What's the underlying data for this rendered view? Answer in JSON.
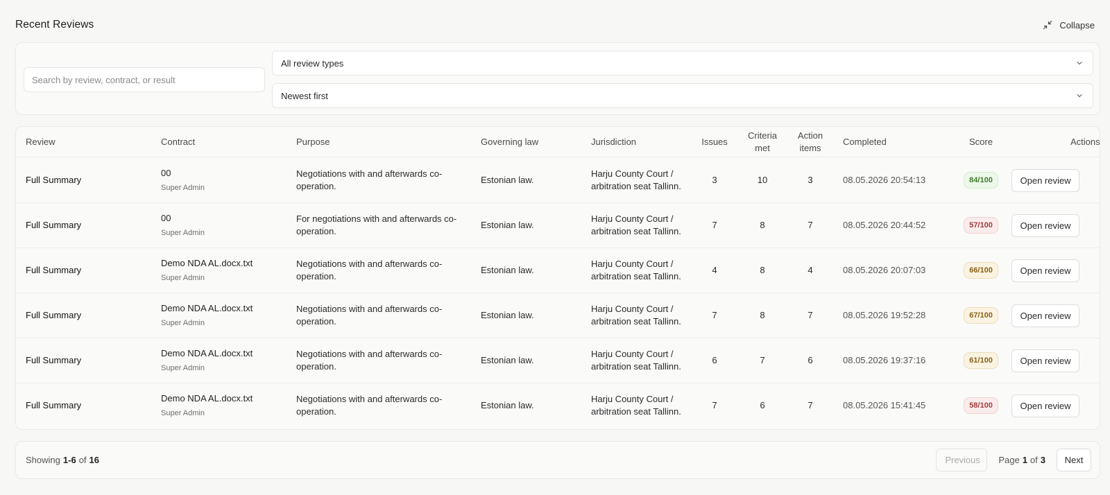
{
  "header": {
    "title": "Recent Reviews",
    "collapse_label": "Collapse"
  },
  "filters": {
    "search_placeholder": "Search by review, contract, or result",
    "type_selected": "All review types",
    "sort_selected": "Newest first"
  },
  "table": {
    "columns": {
      "review": "Review",
      "contract": "Contract",
      "purpose": "Purpose",
      "law": "Governing law",
      "jurisdiction": "Jurisdiction",
      "issues": "Issues",
      "criteria": "Criteria met",
      "action": "Action items",
      "completed": "Completed",
      "score": "Score",
      "actions": "Actions"
    },
    "rows": [
      {
        "review": "Full Summary",
        "contract": "00",
        "owner": "Super Admin",
        "purpose": "Negotiations with and afterwards co-operation.",
        "law": "Estonian law.",
        "jurisdiction": "Harju County Court / arbitration seat Tallinn.",
        "issues": "3",
        "criteria": "10",
        "action": "3",
        "completed": "08.05.2026 20:54:13",
        "score": "84/100",
        "score_level": "green",
        "button": "Open review"
      },
      {
        "review": "Full Summary",
        "contract": "00",
        "owner": "Super Admin",
        "purpose": "For negotiations with and afterwards co-operation.",
        "law": "Estonian law.",
        "jurisdiction": "Harju County Court / arbitration seat Tallinn.",
        "issues": "7",
        "criteria": "8",
        "action": "7",
        "completed": "08.05.2026 20:44:52",
        "score": "57/100",
        "score_level": "red",
        "button": "Open review"
      },
      {
        "review": "Full Summary",
        "contract": "Demo NDA AL.docx.txt",
        "owner": "Super Admin",
        "purpose": "Negotiations with and afterwards co-operation.",
        "law": "Estonian law.",
        "jurisdiction": "Harju County Court / arbitration seat Tallinn.",
        "issues": "4",
        "criteria": "8",
        "action": "4",
        "completed": "08.05.2026 20:07:03",
        "score": "66/100",
        "score_level": "amber",
        "button": "Open review"
      },
      {
        "review": "Full Summary",
        "contract": "Demo NDA AL.docx.txt",
        "owner": "Super Admin",
        "purpose": "Negotiations with and afterwards co-operation.",
        "law": "Estonian law.",
        "jurisdiction": "Harju County Court / arbitration seat Tallinn.",
        "issues": "7",
        "criteria": "8",
        "action": "7",
        "completed": "08.05.2026 19:52:28",
        "score": "67/100",
        "score_level": "amber",
        "button": "Open review"
      },
      {
        "review": "Full Summary",
        "contract": "Demo NDA AL.docx.txt",
        "owner": "Super Admin",
        "purpose": "Negotiations with and afterwards co-operation.",
        "law": "Estonian law.",
        "jurisdiction": "Harju County Court / arbitration seat Tallinn.",
        "issues": "6",
        "criteria": "7",
        "action": "6",
        "completed": "08.05.2026 19:37:16",
        "score": "61/100",
        "score_level": "amber",
        "button": "Open review"
      },
      {
        "review": "Full Summary",
        "contract": "Demo NDA AL.docx.txt",
        "owner": "Super Admin",
        "purpose": "Negotiations with and afterwards co-operation.",
        "law": "Estonian law.",
        "jurisdiction": "Harju County Court / arbitration seat Tallinn.",
        "issues": "7",
        "criteria": "6",
        "action": "7",
        "completed": "08.05.2026 15:41:45",
        "score": "58/100",
        "score_level": "red",
        "button": "Open review"
      }
    ]
  },
  "pagination": {
    "showing_prefix": "Showing",
    "range_start": "1",
    "range_sep": "-",
    "range_end": "6",
    "of_word": "of",
    "total": "16",
    "previous_label": "Previous",
    "next_label": "Next",
    "page_word": "Page",
    "current_page": "1",
    "page_of": "of",
    "total_pages": "3"
  },
  "colors": {
    "background": "#f7f7f6",
    "score_green": "#3e7d2c",
    "score_red": "#a33b3b",
    "score_amber": "#8a6118"
  },
  "icons": {
    "collapse": "collapse-arrows-icon",
    "select": "chevron-down-icon"
  }
}
